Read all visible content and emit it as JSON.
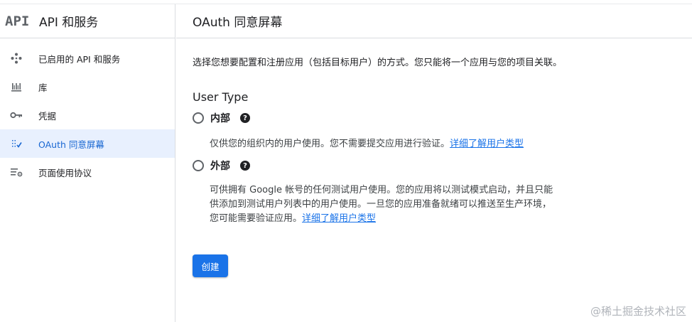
{
  "sidebar": {
    "logo": "API",
    "title": "API 和服务",
    "items": [
      {
        "label": "已启用的 API 和服务",
        "icon": "diamond-dots-icon",
        "active": false
      },
      {
        "label": "库",
        "icon": "library-icon",
        "active": false
      },
      {
        "label": "凭据",
        "icon": "key-icon",
        "active": false
      },
      {
        "label": "OAuth 同意屏幕",
        "icon": "oauth-consent-icon",
        "active": true
      },
      {
        "label": "页面使用协议",
        "icon": "page-settings-icon",
        "active": false
      }
    ]
  },
  "main": {
    "title": "OAuth 同意屏幕",
    "intro": "选择您想要配置和注册应用（包括目标用户）的方式。您只能将一个应用与您的项目关联。",
    "section_title": "User Type",
    "internal": {
      "label": "内部",
      "desc": "仅供您的组织内的用户使用。您不需要提交应用进行验证。",
      "link": "详细了解用户类型"
    },
    "external": {
      "label": "外部",
      "desc": "可供拥有 Google 帐号的任何测试用户使用。您的应用将以测试模式启动，并且只能供添加到测试用户列表中的用户使用。一旦您的应用准备就绪可以推送至生产环境，您可能需要验证应用。",
      "link": "详细了解用户类型"
    },
    "create_button": "创建"
  },
  "watermark": "@稀土掘金技术社区",
  "colors": {
    "accent": "#1a73e8",
    "active_bg": "#e8f0fe",
    "active_text": "#1967d2"
  }
}
